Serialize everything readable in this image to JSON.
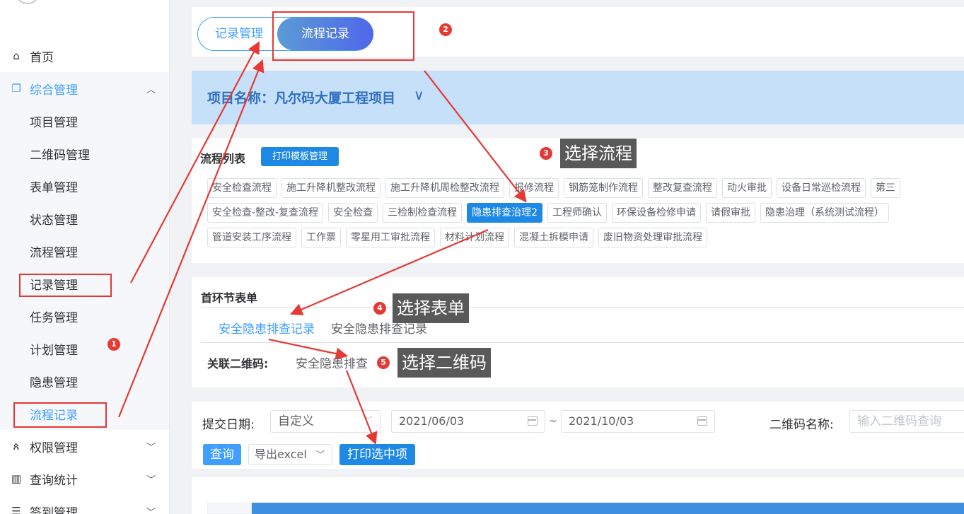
{
  "sidebar": {
    "items": [
      {
        "label": "首页",
        "icon": "home-icon"
      },
      {
        "label": "综合管理",
        "icon": "copy-icon",
        "expanded": true
      },
      {
        "label": "权限管理",
        "icon": "users-icon"
      },
      {
        "label": "查询统计",
        "icon": "bar-chart-icon"
      },
      {
        "label": "签到管理",
        "icon": "list-icon"
      }
    ],
    "sub_items": [
      "项目管理",
      "二维码管理",
      "表单管理",
      "状态管理",
      "流程管理",
      "记录管理",
      "任务管理",
      "计划管理",
      "隐患管理",
      "流程记录"
    ]
  },
  "tabs": {
    "record": "记录管理",
    "flow": "流程记录"
  },
  "project": {
    "title": "项目名称：凡尔码大厦工程项目"
  },
  "flow_list": {
    "title": "流程列表",
    "print_template_button": "打印模板管理",
    "rows": [
      [
        "安全检查流程",
        "施工升降机整改流程",
        "施工升降机周检整改流程",
        "报修流程",
        "钢筋笼制作流程",
        "整改复查流程",
        "动火审批",
        "设备日常巡检流程",
        "第三"
      ],
      [
        "安全检查-整改-复查流程",
        "安全检查",
        "三检制检查流程",
        "隐患排查治理2",
        "工程师确认",
        "环保设备检修申请",
        "请假审批",
        "隐患治理（系统测试流程）"
      ],
      [
        "管道安装工序流程",
        "工作票",
        "零星用工审批流程",
        "材料计划流程",
        "混凝土拆模申请",
        "废旧物资处理审批流程"
      ]
    ],
    "selected": "隐患排查治理2"
  },
  "first_form": {
    "title": "首环节表单",
    "tabs": [
      "安全隐患排查记录",
      "安全隐患排查记录"
    ],
    "qr_label": "关联二维码:",
    "qr_value": "安全隐患排查"
  },
  "filter": {
    "date_label": "提交日期:",
    "date_mode": "自定义",
    "start_date": "2021/06/03",
    "tilde": "~",
    "end_date": "2021/10/03",
    "qr_name_label": "二维码名称:",
    "qr_name_placeholder": "输入二维码查询",
    "query_button": "查询",
    "export_button": "导出excel",
    "print_button": "打印选中项"
  },
  "annotations": {
    "badges": [
      "1",
      "2",
      "3",
      "4",
      "5"
    ],
    "callouts": [
      "选择流程",
      "选择表单",
      "选择二维码"
    ],
    "color": "#e53935"
  },
  "colors": {
    "primary": "#409eff",
    "selected_tag": "#1e88e5",
    "project_bar": "#c6e0f9",
    "project_text": "#2f6fc2"
  }
}
